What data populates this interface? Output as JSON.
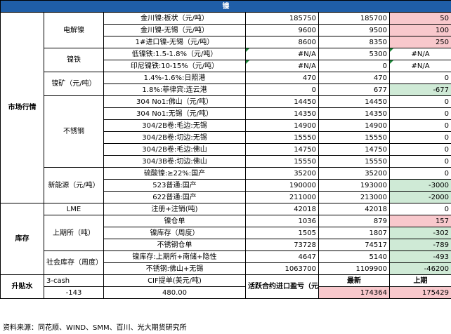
{
  "title": "镍",
  "sections": {
    "market": "市场行情",
    "inventory": "库存",
    "premium": "升贴水"
  },
  "groups": {
    "electrolytic": "电解镍",
    "ferronickel": "镍铁",
    "ore": "镍矿（元/吨）",
    "stainless": "不锈钢",
    "new_energy": "新能源（元/吨）",
    "lme": "LME",
    "shfe": "上期所（吨）",
    "social": "社会库存（周度）"
  },
  "rows": [
    {
      "item": "金川镍:板状（元/吨）",
      "v1": "185750",
      "v2": "185700",
      "chg": "50",
      "tone": "pos"
    },
    {
      "item": "金川镍-无锡（元/吨）",
      "v1": "9600",
      "v2": "9500",
      "chg": "100",
      "tone": "pos"
    },
    {
      "item": "1#进口镍-无锡（元/吨）",
      "v1": "8600",
      "v2": "8350",
      "chg": "250",
      "tone": "pos"
    },
    {
      "item": "低镍铁:1.5-1.8%（元/吨）",
      "v1": "#N/A",
      "v2": "5300",
      "chg": "#N/A",
      "tone": ""
    },
    {
      "item": "印尼镍铁:10-15%（元/吨）",
      "v1": "#N/A",
      "v2": "0",
      "chg": "#N/A",
      "tone": ""
    },
    {
      "item": "1.4%-1.6%:日照港",
      "v1": "470",
      "v2": "470",
      "chg": "0",
      "tone": ""
    },
    {
      "item": "1.8%:菲律宾:连云港",
      "v1": "0",
      "v2": "677",
      "chg": "-677",
      "tone": "neg"
    },
    {
      "item": "304 No1:佛山（元/吨）",
      "v1": "14450",
      "v2": "14450",
      "chg": "0",
      "tone": ""
    },
    {
      "item": "304 No1:无锡（元/吨）",
      "v1": "14350",
      "v2": "14350",
      "chg": "0",
      "tone": ""
    },
    {
      "item": "304/2B卷:毛边:无锡",
      "v1": "14900",
      "v2": "14900",
      "chg": "0",
      "tone": ""
    },
    {
      "item": "304/2B卷:切边:无锡",
      "v1": "15550",
      "v2": "15550",
      "chg": "0",
      "tone": ""
    },
    {
      "item": "304/2B卷:毛边:佛山",
      "v1": "14750",
      "v2": "14750",
      "chg": "0",
      "tone": ""
    },
    {
      "item": "304/3B卷:切边:佛山",
      "v1": "15550",
      "v2": "15550",
      "chg": "0",
      "tone": ""
    },
    {
      "item": "硫酸镍:≥22%:国产",
      "v1": "35200",
      "v2": "35200",
      "chg": "0",
      "tone": ""
    },
    {
      "item": "523普通:国产",
      "v1": "190000",
      "v2": "193000",
      "chg": "-3000",
      "tone": "neg"
    },
    {
      "item": "622普通:国产",
      "v1": "211000",
      "v2": "213000",
      "chg": "-2000",
      "tone": "neg"
    },
    {
      "item": "注册+注销(吨)",
      "v1": "42018",
      "v2": "42018",
      "chg": "0",
      "tone": ""
    },
    {
      "item": "镍仓单",
      "v1": "1036",
      "v2": "879",
      "chg": "157",
      "tone": "pos"
    },
    {
      "item": "镍库存（周度）",
      "v1": "1505",
      "v2": "1807",
      "chg": "-302",
      "tone": "neg"
    },
    {
      "item": "不锈钢仓单",
      "v1": "73728",
      "v2": "74517",
      "chg": "-789",
      "tone": "neg"
    },
    {
      "item": "镍库存:上期所+南储+隐性",
      "v1": "4647",
      "v2": "5140",
      "chg": "-493",
      "tone": "neg"
    },
    {
      "item": "不锈钢:佛山+无锡",
      "v1": "1063700",
      "v2": "1109900",
      "chg": "-46200",
      "tone": "neg"
    }
  ],
  "premium": {
    "label_a": "3-cash",
    "label_b": "CIF提单(美元/吨)",
    "val_a": "-143",
    "val_b": "480.00",
    "profit_label": "活跃合约进口盈亏（元/吨）",
    "latest_label": "最新",
    "prev_label": "上期",
    "latest_val": "174364",
    "prev_val": "175429"
  },
  "footnote": "资料来源：同花顺、WIND、SMM、百川、光大期货研究所",
  "colors": {
    "header_bg": "#1f5ea8",
    "positive_bg": "#f8c8cc",
    "negative_bg": "#cfead6"
  }
}
